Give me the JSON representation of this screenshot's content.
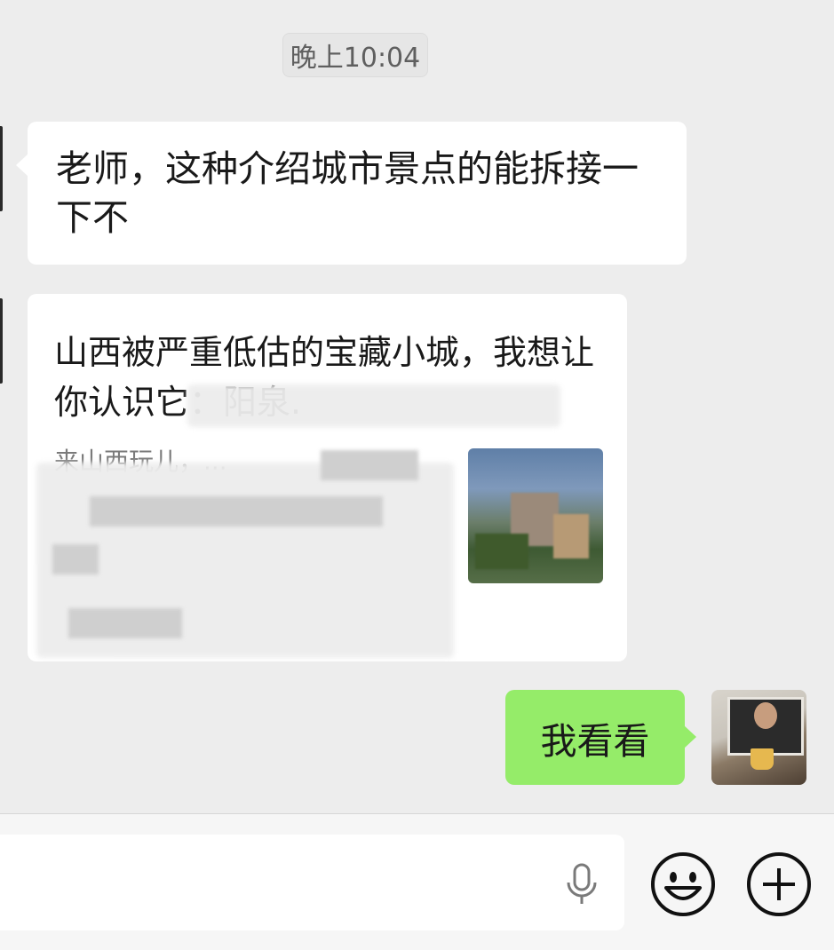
{
  "timestamp": "晚上10:04",
  "messages": [
    {
      "direction": "incoming",
      "text": "老师，这种介绍城市景点的能拆接一下不"
    },
    {
      "direction": "incoming",
      "type": "article-card",
      "title": "山西被严重低估的宝藏小城，我想让你认识它：阳泉.",
      "description": "来山西玩儿，..."
    },
    {
      "direction": "outgoing",
      "text": "我看看"
    }
  ],
  "input_bar": {
    "icons": [
      "microphone-icon",
      "emoji-icon",
      "plus-icon"
    ]
  },
  "colors": {
    "background": "#ededed",
    "incoming_bubble": "#ffffff",
    "outgoing_bubble": "#95ec69"
  }
}
